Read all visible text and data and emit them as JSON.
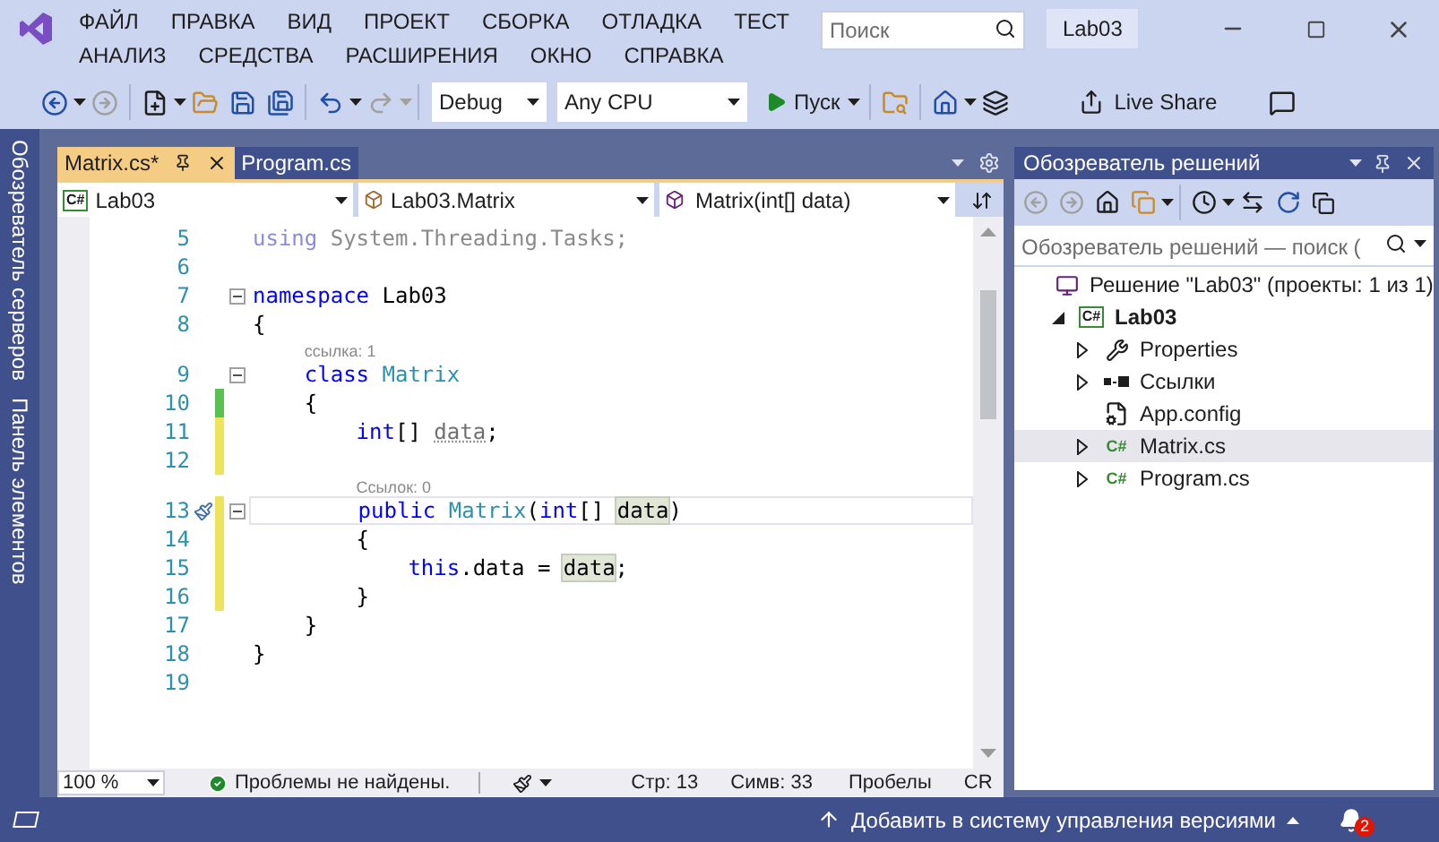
{
  "title_bar": {
    "menu_rows": [
      [
        "ФАЙЛ",
        "ПРАВКА",
        "ВИД",
        "ПРОЕКТ",
        "СБОРКА",
        "ОТЛАДКА",
        "ТЕСТ"
      ],
      [
        "АНАЛИЗ",
        "СРЕДСТВА",
        "РАСШИРЕНИЯ",
        "ОКНО",
        "СПРАВКА"
      ]
    ],
    "search": {
      "placeholder": "Поиск"
    },
    "solution_name": "Lab03"
  },
  "toolbar": {
    "configuration": "Debug",
    "platform": "Any CPU",
    "start": "Пуск",
    "live_share": "Live Share"
  },
  "side_tabs": [
    "Обозреватель серверов",
    "Панель элементов"
  ],
  "editor": {
    "tabs": [
      {
        "label": "Matrix.cs*",
        "selected": true
      },
      {
        "label": "Program.cs",
        "selected": false
      }
    ],
    "navigation": {
      "project_icon": "C#",
      "project": "Lab03",
      "type": "Lab03.Matrix",
      "member": "Matrix(int[] data)"
    },
    "lines": [
      {
        "kind": "code",
        "number": "5",
        "fold": false,
        "current": false,
        "tokens": [
          {
            "text": "using",
            "kind": "faded-keyword"
          },
          {
            "text": " System.Threading.Tasks;",
            "kind": "faded"
          }
        ]
      },
      {
        "kind": "code",
        "number": "6",
        "fold": false,
        "current": false
      },
      {
        "kind": "code",
        "number": "7",
        "fold": true,
        "current": false,
        "tokens": [
          {
            "text": "namespace",
            "kind": "keyword"
          },
          {
            "text": " Lab03",
            "kind": "plain"
          }
        ]
      },
      {
        "kind": "code",
        "number": "8",
        "fold": false,
        "current": false,
        "tokens": [
          {
            "text": "{",
            "kind": "plain"
          }
        ]
      },
      {
        "kind": "lens",
        "text": "ссылка: 1"
      },
      {
        "kind": "code",
        "number": "9",
        "fold": true,
        "current": false,
        "tokens": [
          {
            "text": "    class",
            "kind": "keyword"
          },
          {
            "text": " Matrix",
            "kind": "type"
          }
        ]
      },
      {
        "kind": "code",
        "number": "10",
        "color": "#57c152",
        "fold": false,
        "current": false,
        "tokens": [
          {
            "text": "    {",
            "kind": "plain"
          }
        ]
      },
      {
        "kind": "code",
        "number": "11",
        "color": "#eee35a",
        "fold": false,
        "current": false,
        "tokens": [
          {
            "text": "        int",
            "kind": "keyword"
          },
          {
            "text": "[] ",
            "kind": "plain"
          },
          {
            "text": "data",
            "kind": "unused"
          },
          {
            "text": ";",
            "kind": "plain"
          }
        ]
      },
      {
        "kind": "code",
        "number": "12",
        "color": "#eee35a",
        "fold": false,
        "current": false
      },
      {
        "kind": "lens",
        "text": "Ссылок: 0"
      },
      {
        "kind": "code",
        "number": "13",
        "color": "#eee35a",
        "fold": true,
        "current": true,
        "tokens": [
          {
            "text": "        public",
            "kind": "keyword"
          },
          {
            "text": " Matrix",
            "kind": "type"
          },
          {
            "text": "(",
            "kind": "plain"
          },
          {
            "text": "int",
            "kind": "keyword"
          },
          {
            "text": "[] ",
            "kind": "plain"
          },
          {
            "text": "data",
            "kind": "highlight"
          },
          {
            "text": ")",
            "kind": "plain"
          }
        ]
      },
      {
        "kind": "code",
        "number": "14",
        "color": "#eee35a",
        "fold": false,
        "current": false,
        "tokens": [
          {
            "text": "        {",
            "kind": "plain"
          }
        ]
      },
      {
        "kind": "code",
        "number": "15",
        "color": "#eee35a",
        "fold": false,
        "current": false,
        "tokens": [
          {
            "text": "            this",
            "kind": "keyword"
          },
          {
            "text": ".data = ",
            "kind": "plain"
          },
          {
            "text": "data",
            "kind": "highlight"
          },
          {
            "text": ";",
            "kind": "plain"
          }
        ]
      },
      {
        "kind": "code",
        "number": "16",
        "color": "#eee35a",
        "fold": false,
        "current": false,
        "tokens": [
          {
            "text": "        }",
            "kind": "plain"
          }
        ]
      },
      {
        "kind": "code",
        "number": "17",
        "fold": false,
        "current": false,
        "tokens": [
          {
            "text": "    }",
            "kind": "plain"
          }
        ]
      },
      {
        "kind": "code",
        "number": "18",
        "fold": false,
        "current": false,
        "tokens": [
          {
            "text": "}",
            "kind": "plain"
          }
        ]
      },
      {
        "kind": "code",
        "number": "19",
        "fold": false,
        "current": false
      }
    ],
    "zoom": "100 %",
    "problems": "Проблемы не найдены.",
    "line": "Стр: 13",
    "column": "Симв: 33",
    "whitespace": "Пробелы",
    "line_ending": "CR"
  },
  "solution_explorer": {
    "title": "Обозреватель решений",
    "search": {
      "placeholder": "Обозреватель решений — поиск ("
    },
    "tree": [
      {
        "label": "Решение \"Lab03\" (проекты: 1 из 1)",
        "kind": "solution",
        "selected": false,
        "children": [
          {
            "label": "Lab03",
            "icon_text": "C#",
            "kind": "project",
            "expanded": true,
            "selected": false,
            "children": [
              {
                "label": "Properties",
                "kind": "properties",
                "expanded": false,
                "selected": false
              },
              {
                "label": "Ссылки",
                "kind": "references",
                "expanded": false,
                "selected": false
              },
              {
                "label": "App.config",
                "kind": "config",
                "selected": false
              },
              {
                "label": "Matrix.cs",
                "icon_text": "C#",
                "kind": "csharp",
                "expanded": false,
                "selected": true
              },
              {
                "label": "Program.cs",
                "icon_text": "C#",
                "kind": "csharp",
                "expanded": false,
                "selected": false
              }
            ]
          }
        ]
      }
    ]
  },
  "status_bar": {
    "source_control": "Добавить в систему управления версиями",
    "notifications": "2"
  }
}
